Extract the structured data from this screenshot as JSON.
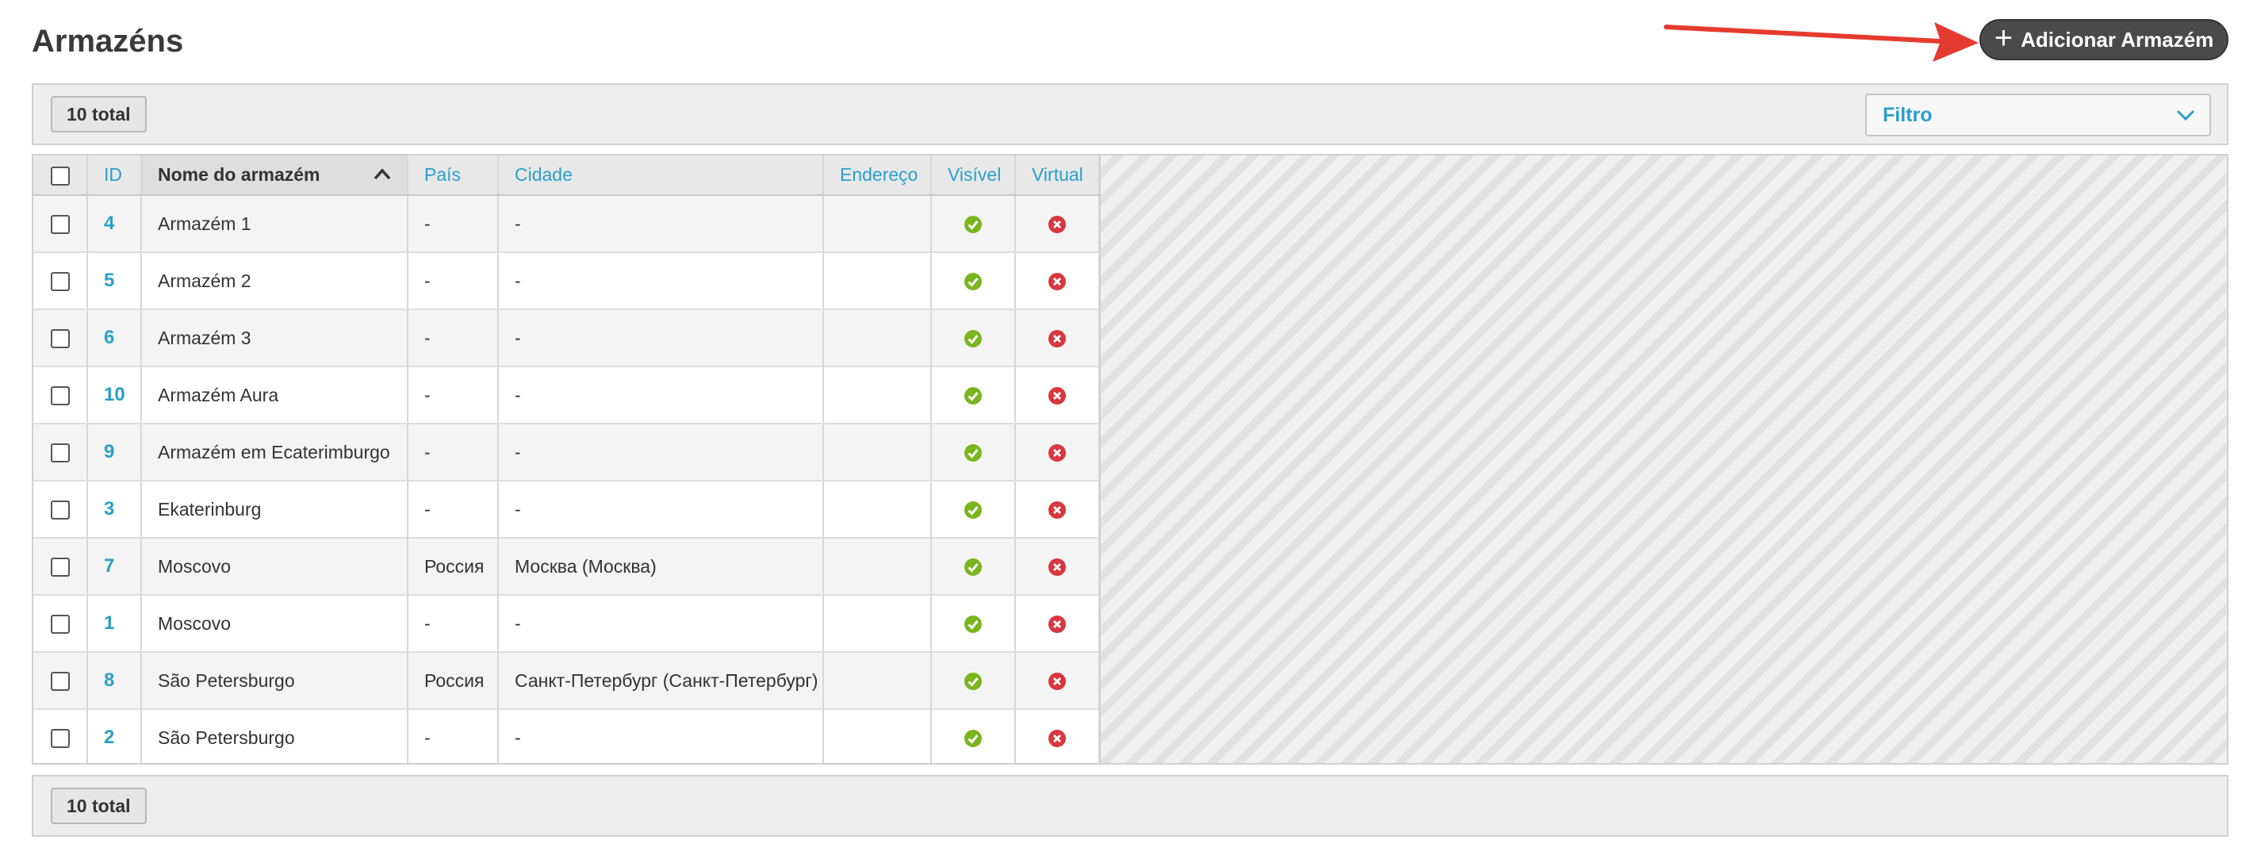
{
  "page": {
    "title": "Armazéns",
    "add_button_label": "Adicionar Armazém"
  },
  "toolbar": {
    "total_label": "10 total",
    "filter_label": "Filtro"
  },
  "table": {
    "columns": {
      "id": "ID",
      "name": "Nome do armazém",
      "country": "País",
      "city": "Cidade",
      "address": "Endereço",
      "visible": "Visível",
      "virtual": "Virtual"
    },
    "rows": [
      {
        "id": "4",
        "name": "Armazém 1",
        "country": "-",
        "city": "-",
        "address": "",
        "visible": true,
        "virtual": false
      },
      {
        "id": "5",
        "name": "Armazém 2",
        "country": "-",
        "city": "-",
        "address": "",
        "visible": true,
        "virtual": false
      },
      {
        "id": "6",
        "name": "Armazém 3",
        "country": "-",
        "city": "-",
        "address": "",
        "visible": true,
        "virtual": false
      },
      {
        "id": "10",
        "name": "Armazém Aura",
        "country": "-",
        "city": "-",
        "address": "",
        "visible": true,
        "virtual": false
      },
      {
        "id": "9",
        "name": "Armazém em Ecaterimburgo",
        "country": "-",
        "city": "-",
        "address": "",
        "visible": true,
        "virtual": false
      },
      {
        "id": "3",
        "name": "Ekaterinburg",
        "country": "-",
        "city": "-",
        "address": "",
        "visible": true,
        "virtual": false
      },
      {
        "id": "7",
        "name": "Moscovo",
        "country": "Россия",
        "city": "Москва (Москва)",
        "address": "",
        "visible": true,
        "virtual": false
      },
      {
        "id": "1",
        "name": "Moscovo",
        "country": "-",
        "city": "-",
        "address": "",
        "visible": true,
        "virtual": false
      },
      {
        "id": "8",
        "name": "São Petersburgo",
        "country": "Россия",
        "city": "Санкт-Петербург (Санкт-Петербург)",
        "address": "",
        "visible": true,
        "virtual": false
      },
      {
        "id": "2",
        "name": "São Petersburgo",
        "country": "-",
        "city": "-",
        "address": "",
        "visible": true,
        "virtual": false
      }
    ]
  },
  "icons": {
    "add": "plus-icon",
    "filter": "chevron-down-icon",
    "sort": "sort-ascending-icon",
    "visible_true": "check-circle-icon",
    "virtual_false": "x-circle-icon",
    "annotation": "red-arrow-icon"
  },
  "colors": {
    "accent": "#2a9fc9",
    "success": "#7ab51d",
    "danger": "#d9363e",
    "button_dark": "#4a4a4a",
    "annotation_arrow": "#e53b2f"
  }
}
